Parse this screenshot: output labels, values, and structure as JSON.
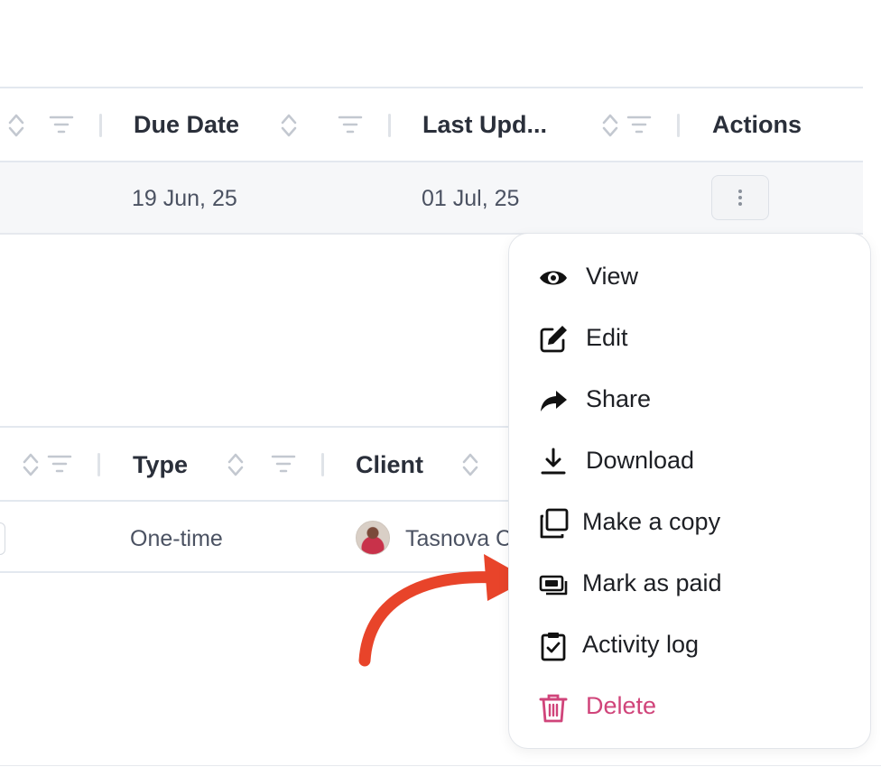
{
  "table_top": {
    "headers": {
      "due_date": "Due Date",
      "last_updated": "Last Upd...",
      "actions": "Actions"
    },
    "row": {
      "due_date": "19 Jun, 25",
      "last_updated": "01 Jul, 25"
    }
  },
  "table_bottom": {
    "headers": {
      "type": "Type",
      "client": "Client"
    },
    "row": {
      "type": "One-time",
      "client": "Tasnova C"
    }
  },
  "menu": {
    "items": [
      {
        "label": "View",
        "icon": "eye-icon"
      },
      {
        "label": "Edit",
        "icon": "edit-icon"
      },
      {
        "label": "Share",
        "icon": "share-icon"
      },
      {
        "label": "Download",
        "icon": "download-icon"
      },
      {
        "label": "Make a copy",
        "icon": "copy-icon"
      },
      {
        "label": "Mark as paid",
        "icon": "payment-icon"
      },
      {
        "label": "Activity log",
        "icon": "clipboard-check-icon"
      },
      {
        "label": "Delete",
        "icon": "trash-icon"
      }
    ]
  },
  "colors": {
    "danger": "#d0447a",
    "annotation_arrow": "#e8442a"
  }
}
